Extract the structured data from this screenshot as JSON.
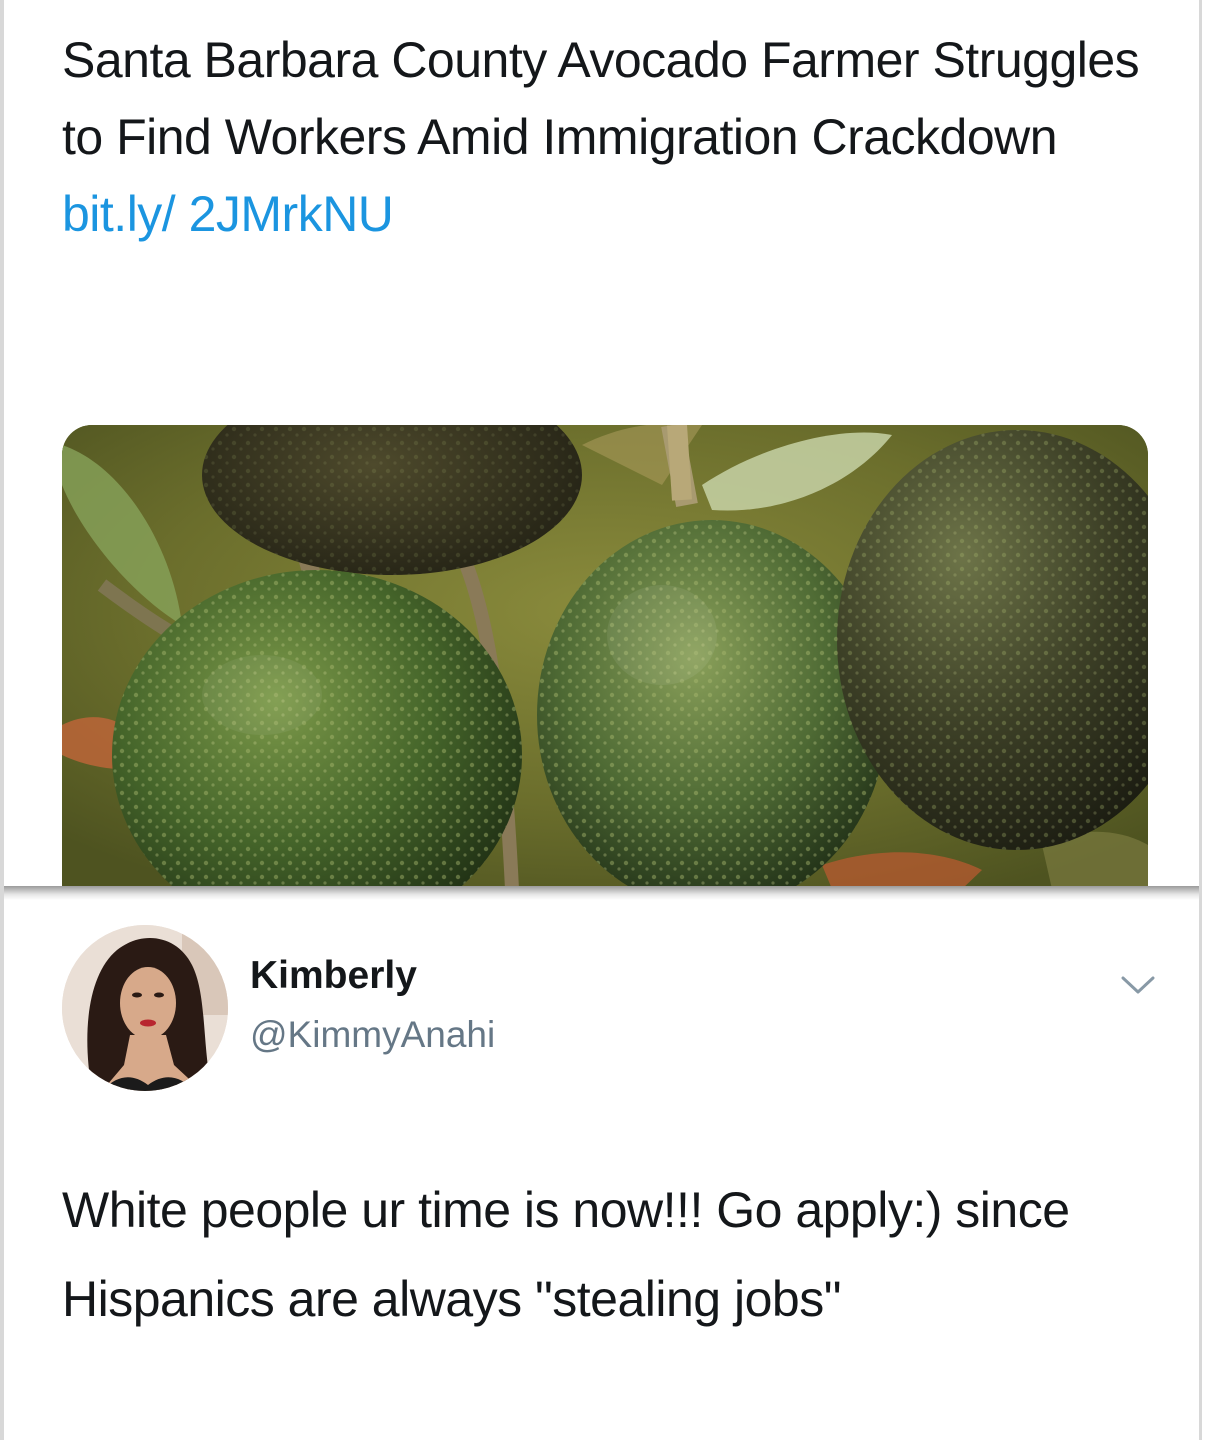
{
  "upper_tweet": {
    "text": "Santa Barbara County Avocado Farmer Struggles to Find Workers Amid Immigration Crackdown ",
    "link_text": "bit.ly/ 2JMrkNU",
    "link_color": "#1b95e0",
    "image_subject": "avocados-on-tree"
  },
  "reply_tweet": {
    "display_name": "Kimberly",
    "handle": "@KimmyAnahi",
    "text": "White people ur time is now!!! Go apply:) since Hispanics are always \"stealing jobs\"",
    "menu_icon": "chevron-down-icon",
    "handle_color": "#657786"
  }
}
